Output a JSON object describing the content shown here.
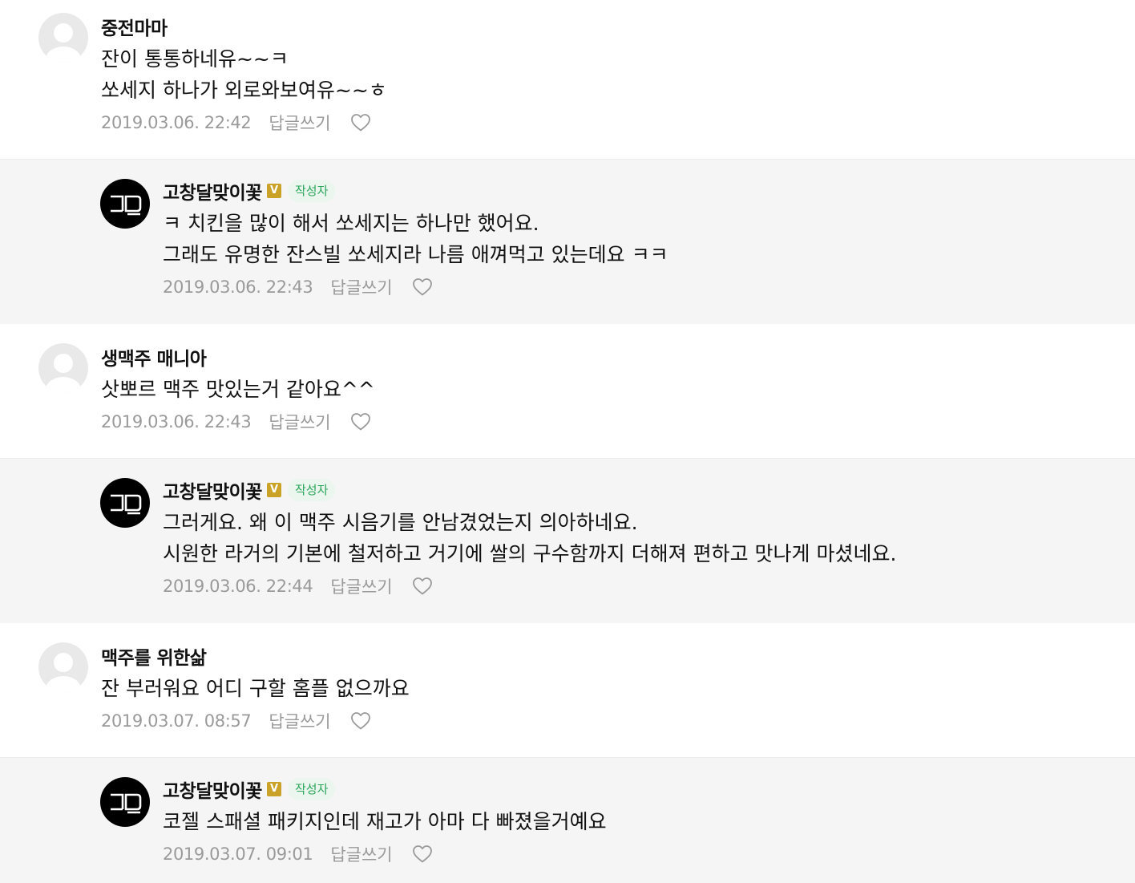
{
  "comments": [
    {
      "author": "중전마마",
      "lines": [
        "잔이 통통하네유~~ㅋ",
        "쏘세지 하나가 외로와보여유~~ㅎ"
      ],
      "date": "2019.03.06. 22:42",
      "reply_label": "답글쓰기",
      "is_reply": false
    },
    {
      "author": "고창달맞이꽃",
      "badge_v": "V",
      "badge_author": "작성자",
      "lines": [
        "ㅋ 치킨을 많이 해서 쏘세지는 하나만 했어요.",
        "그래도 유명한 잔스빌 쏘세지라 나름 애껴먹고 있는데요 ㅋㅋ"
      ],
      "date": "2019.03.06. 22:43",
      "reply_label": "답글쓰기",
      "is_reply": true
    },
    {
      "author": "생맥주 매니아",
      "lines": [
        "삿뽀르 맥주 맛있는거 같아요^^"
      ],
      "date": "2019.03.06. 22:43",
      "reply_label": "답글쓰기",
      "is_reply": false
    },
    {
      "author": "고창달맞이꽃",
      "badge_v": "V",
      "badge_author": "작성자",
      "lines": [
        "그러게요. 왜 이 맥주 시음기를 안남겼었는지 의아하네요.",
        "시원한 라거의 기본에 철저하고 거기에 쌀의 구수함까지 더해져 편하고 맛나게 마셨네요."
      ],
      "date": "2019.03.06. 22:44",
      "reply_label": "답글쓰기",
      "is_reply": true
    },
    {
      "author": "맥주를 위한삶",
      "lines": [
        "잔 부러워요 어디 구할 홈플 없으까요"
      ],
      "date": "2019.03.07. 08:57",
      "reply_label": "답글쓰기",
      "is_reply": false
    },
    {
      "author": "고창달맞이꽃",
      "badge_v": "V",
      "badge_author": "작성자",
      "lines": [
        "코젤 스패셜 패키지인데 재고가 아마 다 빠졌을거예요"
      ],
      "date": "2019.03.07. 09:01",
      "reply_label": "답글쓰기",
      "is_reply": true
    }
  ],
  "icons": {
    "default_avatar": "person-silhouette-icon",
    "author_avatar": "logo-gd-icon",
    "like": "heart-outline-icon"
  },
  "colors": {
    "reply_background": "#f5f5f5",
    "author_badge_text": "#2aa55a",
    "v_badge": "#c9a227",
    "meta_text": "#9a9a9a"
  }
}
